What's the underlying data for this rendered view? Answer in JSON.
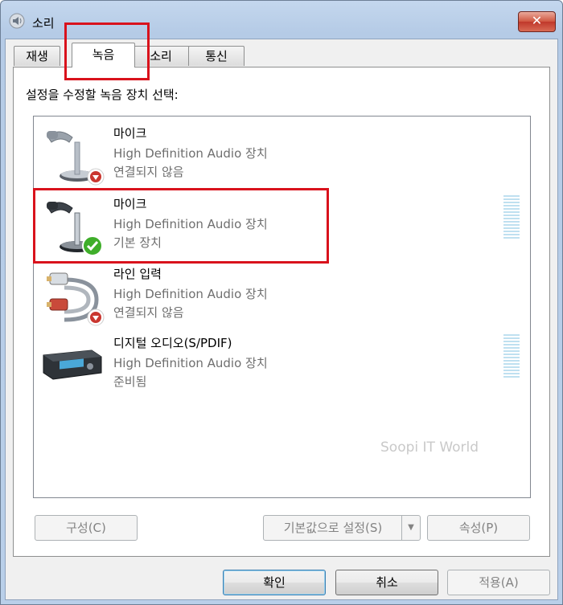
{
  "window": {
    "title": "소리",
    "close_label": "✕",
    "colors": {
      "accent_red": "#d9121c",
      "title_gradient": "#b5cbe6"
    }
  },
  "tabs": [
    {
      "label": "재생",
      "active": false
    },
    {
      "label": "녹음",
      "active": true
    },
    {
      "label": "소리",
      "active": false
    },
    {
      "label": "통신",
      "active": false
    }
  ],
  "instruction": "설정을 수정할 녹음 장치 선택:",
  "devices": [
    {
      "name": "마이크",
      "description": "High Definition Audio 장치",
      "status": "연결되지 않음",
      "icon": "microphone-icon",
      "badge": "disconnected-badge-icon"
    },
    {
      "name": "마이크",
      "description": "High Definition Audio 장치",
      "status": "기본 장치",
      "icon": "microphone-icon",
      "badge": "default-check-badge-icon",
      "level_meter": true
    },
    {
      "name": "라인 입력",
      "description": "High Definition Audio 장치",
      "status": "연결되지 않음",
      "icon": "line-in-cable-icon",
      "badge": "disconnected-badge-icon"
    },
    {
      "name": "디지털 오디오(S/PDIF)",
      "description": "High Definition Audio 장치",
      "status": "준비됨",
      "icon": "digital-audio-receiver-icon",
      "level_meter": true
    }
  ],
  "watermark": "Soopi IT World",
  "buttons": {
    "configure": "구성(C)",
    "set_default": "기본값으로 설정(S)",
    "set_default_arrow": "▼",
    "properties": "속성(P)",
    "ok": "확인",
    "cancel": "취소",
    "apply": "적용(A)"
  }
}
